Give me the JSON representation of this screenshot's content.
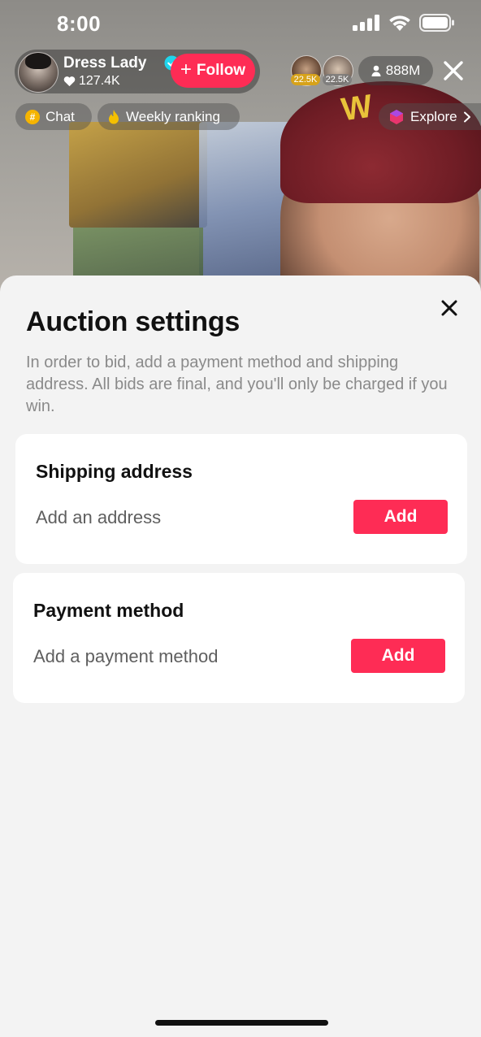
{
  "status_bar": {
    "time": "8:00"
  },
  "live": {
    "host_name": "Dress Lady",
    "likes": "127.4K",
    "follow_label": "Follow",
    "viewer_badges": [
      "22.5K",
      "22.5K"
    ],
    "viewer_count": "888M",
    "chips": {
      "chat": "Chat",
      "weekly_ranking": "Weekly ranking",
      "explore": "Explore"
    }
  },
  "sheet": {
    "title": "Auction settings",
    "description": "In order to bid, add a payment method and shipping address. All bids are final, and you'll only be charged if you win.",
    "shipping": {
      "title": "Shipping address",
      "subtitle": "Add an address",
      "button_label": "Add"
    },
    "payment": {
      "title": "Payment method",
      "subtitle": "Add a payment method",
      "button_label": "Add"
    }
  },
  "colors": {
    "accent": "#fe2c55",
    "sheet_background": "#f3f3f3",
    "card_background": "#ffffff",
    "verified": "#20d5ec"
  },
  "icons": [
    "signal-icon",
    "wifi-icon",
    "battery-icon",
    "verified-icon",
    "heart-icon",
    "plus-icon",
    "person-icon",
    "close-icon",
    "hashtag-icon",
    "flame-icon",
    "explore-icon",
    "chevron-right-icon"
  ]
}
